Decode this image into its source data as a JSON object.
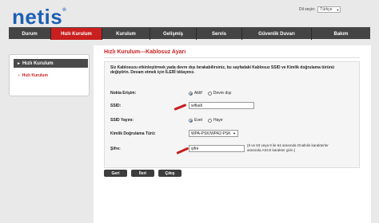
{
  "header": {
    "logo_text": "netis",
    "logo_mark": "®",
    "lang_label": "Dil seçin:",
    "lang_value": "Türkçe"
  },
  "nav": [
    {
      "label": "Durum",
      "active": false
    },
    {
      "label": "Hızlı Kurulum",
      "active": true
    },
    {
      "label": "Kurulum",
      "active": false
    },
    {
      "label": "Gelişmiş",
      "active": false
    },
    {
      "label": "Servis",
      "active": false
    },
    {
      "label": "Güvenlik Duvarı",
      "active": false
    },
    {
      "label": "Bakım",
      "active": false
    }
  ],
  "sidebar": {
    "heading": "Hızlı Kurulum",
    "item": "Hızlı Kurulum"
  },
  "main": {
    "title": "Hızlı Kurulum---Kablosuz Ayarı",
    "description": "Siz Kablosuzu etkinleştirmek yada devre dışı bırakabilirsiniz, bu sayfadaki Kablosuz SSID ve Kimlik doğrulama türünü değiştirin. Devam etmek için İLERİ tıklayınız.",
    "access_point": {
      "label": "Nokta Erişim:",
      "options": [
        "Aktif",
        "Devre dışı"
      ],
      "selected": "Aktif"
    },
    "ssid": {
      "label": "SSID:",
      "value": "wifiadi"
    },
    "ssid_broadcast": {
      "label": "SSID Yayını:",
      "options": [
        "Evet",
        "Hayır"
      ],
      "selected": "Evet"
    },
    "auth_type": {
      "label": "Kimlik Doğrulama Türü:",
      "value": "WPA-PSK/WPA2-PSK"
    },
    "password": {
      "label": "Şifre:",
      "value": "şifre",
      "hint_line1": "(8 ve 63 veya 8 ile 64 arasında Onaltılık karakterler",
      "hint_line2": "arasında ASCII karakter girin.)"
    },
    "buttons": {
      "back": "Geri",
      "next": "İleri",
      "exit": "Çıkış"
    }
  },
  "colors": {
    "accent": "#c91f1f",
    "nav_bg": "#444444",
    "logo": "#1c5fb4"
  }
}
